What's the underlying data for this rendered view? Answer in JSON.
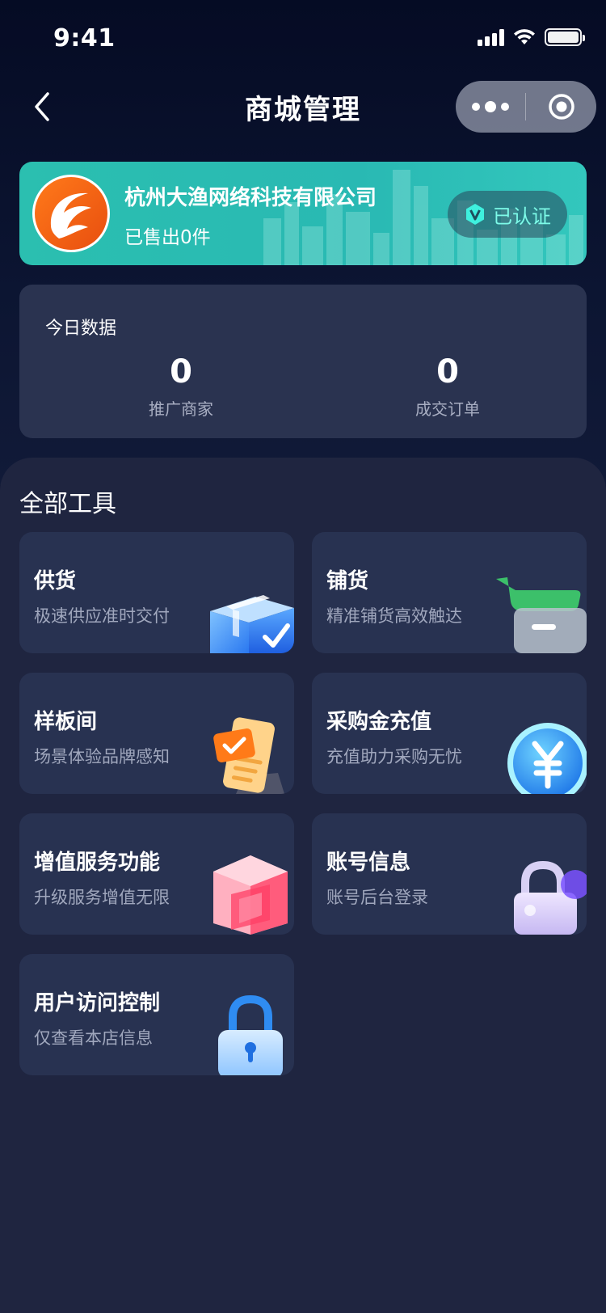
{
  "status_bar": {
    "time": "9:41"
  },
  "nav": {
    "title": "商城管理"
  },
  "company": {
    "name": "杭州大渔网络科技有限公司",
    "sold": "已售出0件",
    "verified_label": "已认证"
  },
  "today": {
    "title": "今日数据",
    "stats": [
      {
        "value": "0",
        "label": "推广商家"
      },
      {
        "value": "0",
        "label": "成交订单"
      }
    ]
  },
  "tools": {
    "title": "全部工具",
    "items": [
      {
        "name": "供货",
        "desc": "极速供应准时交付",
        "icon": "box-icon"
      },
      {
        "name": "铺货",
        "desc": "精准铺货高效触达",
        "icon": "cart-icon"
      },
      {
        "name": "样板间",
        "desc": "场景体验品牌感知",
        "icon": "checklist-icon"
      },
      {
        "name": "采购金充值",
        "desc": "充值助力采购无忧",
        "icon": "yuan-coin-icon"
      },
      {
        "name": "增值服务功能",
        "desc": "升级服务增值无限",
        "icon": "cube-icon"
      },
      {
        "name": "账号信息",
        "desc": "账号后台登录",
        "icon": "account-lock-icon"
      },
      {
        "name": "用户访问控制",
        "desc": "仅查看本店信息",
        "icon": "blue-lock-icon"
      }
    ]
  },
  "colors": {
    "background": "#0b1333",
    "card": "#2a3350",
    "panel": "#1f2540",
    "company_card": "#2bbfb0",
    "verified_text": "#7dfbe8"
  }
}
